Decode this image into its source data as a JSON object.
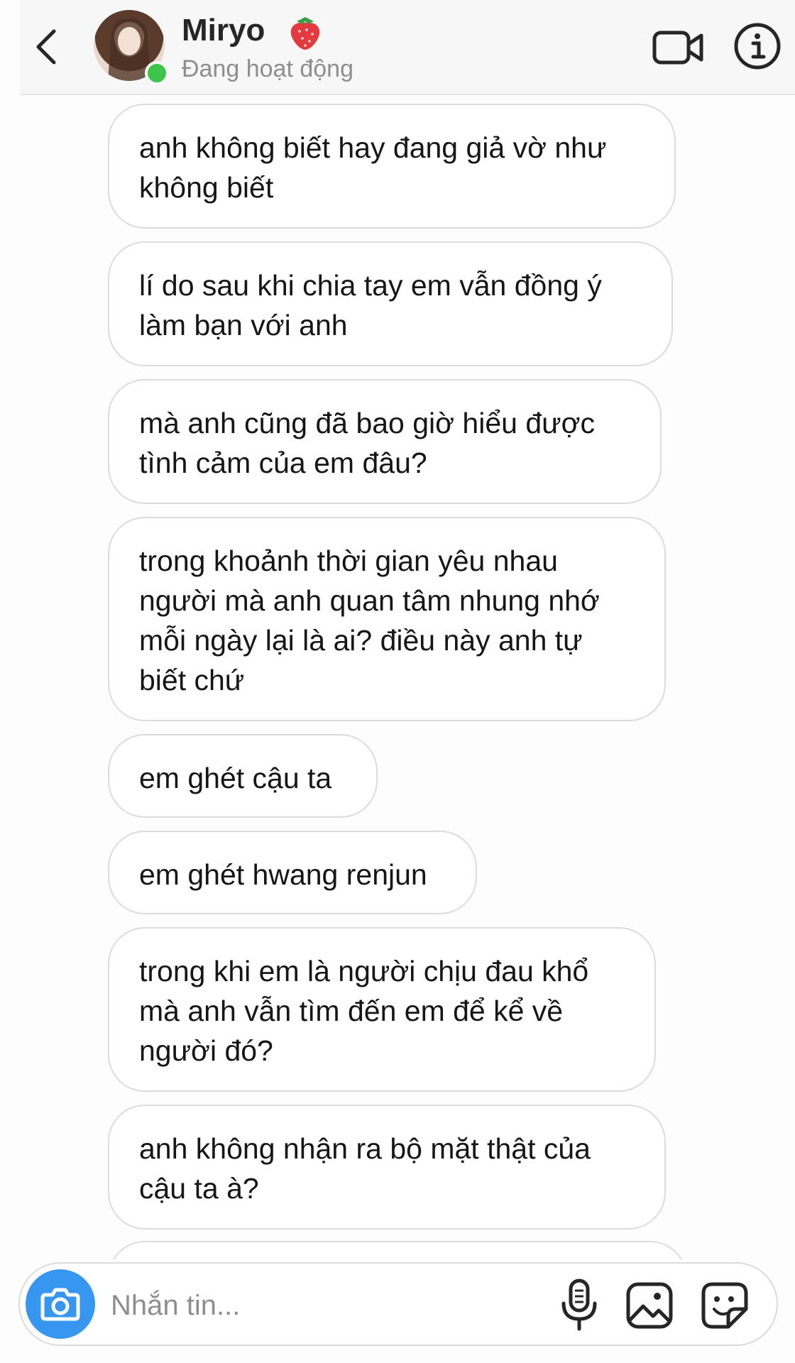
{
  "header": {
    "contact_name": "Miryo",
    "status": "Đang hoạt động",
    "online_color": "#3cc54a",
    "icons": [
      "back-chevron-icon",
      "strawberry-emoji-icon",
      "video-call-icon",
      "info-icon"
    ]
  },
  "messages": [
    {
      "text": "anh không biết hay đang giả vờ như\nkhông biết"
    },
    {
      "text": "lí do sau khi chia tay em vẫn đồng ý\nlàm bạn với anh"
    },
    {
      "text": "mà anh cũng đã bao giờ hiểu được\ntình cảm của em đâu?"
    },
    {
      "text": "trong khoảnh thời gian yêu nhau\nngười mà anh quan tâm nhung nhớ\nmỗi ngày lại là ai? điều này anh tự\nbiết chứ"
    },
    {
      "text": "em ghét cậu ta"
    },
    {
      "text": "em ghét hwang renjun"
    },
    {
      "text": "trong khi em là người chịu đau khổ\nmà anh vẫn tìm đến em để kể về\nngười đó?"
    },
    {
      "text": "anh không nhận ra bộ mặt thật của\ncậu ta à?"
    }
  ],
  "composer": {
    "placeholder": "Nhắn tin...",
    "value": "",
    "accent_color": "#3797f0",
    "icons": [
      "camera-icon",
      "microphone-icon",
      "gallery-icon",
      "sticker-icon"
    ]
  }
}
